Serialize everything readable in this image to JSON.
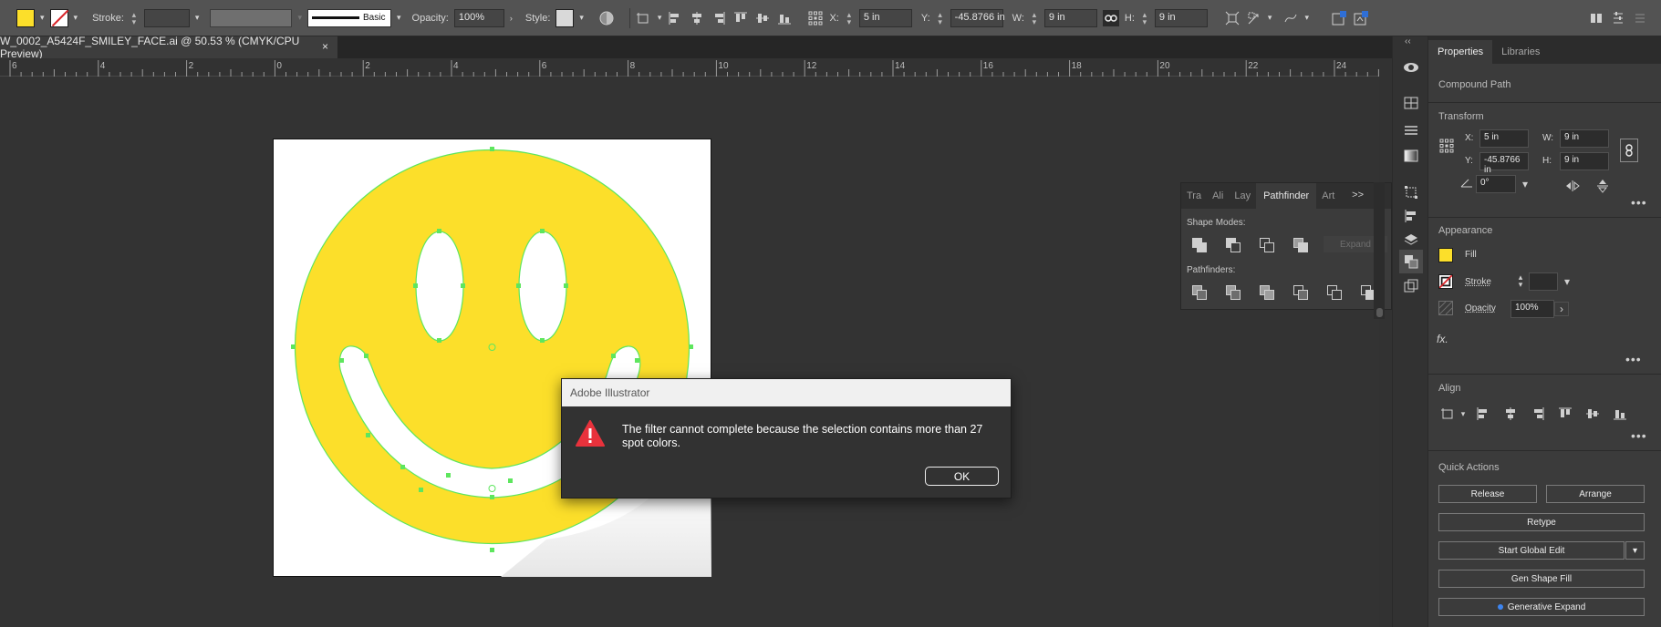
{
  "control_bar": {
    "stroke_label": "Stroke:",
    "brush_label": "Basic",
    "opacity_label": "Opacity:",
    "opacity_value": "100%",
    "style_label": "Style:",
    "x_label": "X:",
    "x_value": "5 in",
    "y_label": "Y:",
    "y_value": "-45.8766 in",
    "w_label": "W:",
    "w_value": "9 in",
    "h_label": "H:",
    "h_value": "9 in",
    "fill_color": "#fcdf2a"
  },
  "document": {
    "tab_title": "W_0002_A5424F_SMILEY_FACE.ai @ 50.53 % (CMYK/CPU Preview)",
    "close_glyph": "×"
  },
  "ruler": {
    "labels": [
      "6",
      "4",
      "2",
      "0",
      "2",
      "4",
      "6",
      "8",
      "10",
      "12",
      "14",
      "16",
      "18",
      "20",
      "22",
      "24"
    ]
  },
  "pathfinder_panel": {
    "tabs": [
      "Tra",
      "Ali",
      "Lay",
      "Pathfinder",
      "Art"
    ],
    "active_tab": "Pathfinder",
    "shape_modes_label": "Shape Modes:",
    "pathfinders_label": "Pathfinders:",
    "expand_label": "Expand",
    "more_glyph": ">>"
  },
  "properties": {
    "tabs": [
      "Properties",
      "Libraries"
    ],
    "active_tab": "Properties",
    "object_type": "Compound Path",
    "transform": {
      "heading": "Transform",
      "x_label": "X:",
      "x_value": "5 in",
      "y_label": "Y:",
      "y_value": "-45.8766 in",
      "w_label": "W:",
      "w_value": "9 in",
      "h_label": "H:",
      "h_value": "9 in",
      "angle_value": "0°"
    },
    "appearance": {
      "heading": "Appearance",
      "fill_label": "Fill",
      "stroke_label": "Stroke",
      "opacity_label": "Opacity",
      "opacity_value": "100%",
      "fx_label": "fx."
    },
    "align": {
      "heading": "Align"
    },
    "quick_actions": {
      "heading": "Quick Actions",
      "release": "Release",
      "arrange": "Arrange",
      "retype": "Retype",
      "start_global_edit": "Start Global Edit",
      "gen_shape_fill": "Gen Shape Fill",
      "generative_expand": "Generative Expand"
    }
  },
  "dialog": {
    "title": "Adobe Illustrator",
    "message": "The filter cannot complete because the selection contains more than 27 spot colors.",
    "ok_label": "OK"
  },
  "colors": {
    "smiley_yellow": "#fcdf2a",
    "selection_green": "#5ee65e",
    "warning_red": "#e8323c"
  }
}
